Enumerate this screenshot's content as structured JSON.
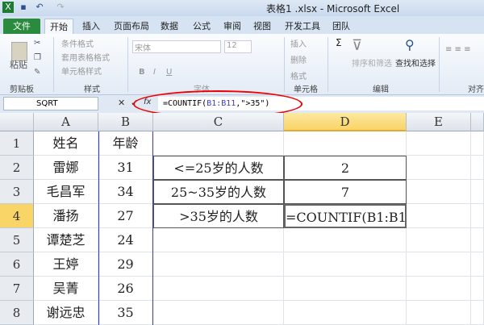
{
  "window": {
    "title": "表格1 .xlsx - Microsoft Excel"
  },
  "ribbon_tabs": [
    "文件",
    "开始",
    "插入",
    "页面布局",
    "数据",
    "公式",
    "审阅",
    "视图",
    "开发工具",
    "团队"
  ],
  "ribbon": {
    "clipboard": {
      "paste": "粘贴",
      "label": "剪贴板"
    },
    "styles": {
      "items": [
        "条件格式",
        "套用表格格式",
        "单元格样式"
      ],
      "label": "样式"
    },
    "font": {
      "name": "宋体",
      "size": "12",
      "label": "字体",
      "bold": "B",
      "italic": "I",
      "underline": "U"
    },
    "cells": {
      "items": [
        "插入",
        "删除",
        "格式"
      ],
      "label": "单元格"
    },
    "editing": {
      "sort": "排序和筛选",
      "find": "查找和选择",
      "label": "编辑",
      "sum": "Σ"
    },
    "align": {
      "label": "对齐"
    }
  },
  "formula_bar": {
    "name_box": "SQRT",
    "fx": "fx",
    "formula_prefix": "=COUNTIF(",
    "formula_ref": "B1:B11",
    "formula_suffix": ",\">35\")"
  },
  "columns": [
    "A",
    "B",
    "C",
    "D",
    "E"
  ],
  "rows": [
    "1",
    "2",
    "3",
    "4",
    "5",
    "6",
    "7",
    "8"
  ],
  "cells": {
    "A": [
      "姓名",
      "雷娜",
      "毛昌军",
      "潘扬",
      "谭楚芝",
      "王婷",
      "吴菁",
      "谢远忠"
    ],
    "B": [
      "年龄",
      "31",
      "34",
      "27",
      "24",
      "29",
      "26",
      "35"
    ],
    "C2": "<=25岁的人数",
    "C3": "25~35岁的人数",
    "C4": ">35岁的人数",
    "D2": "2",
    "D3": "7",
    "D4": "=COUNTIF(B1:B1"
  }
}
